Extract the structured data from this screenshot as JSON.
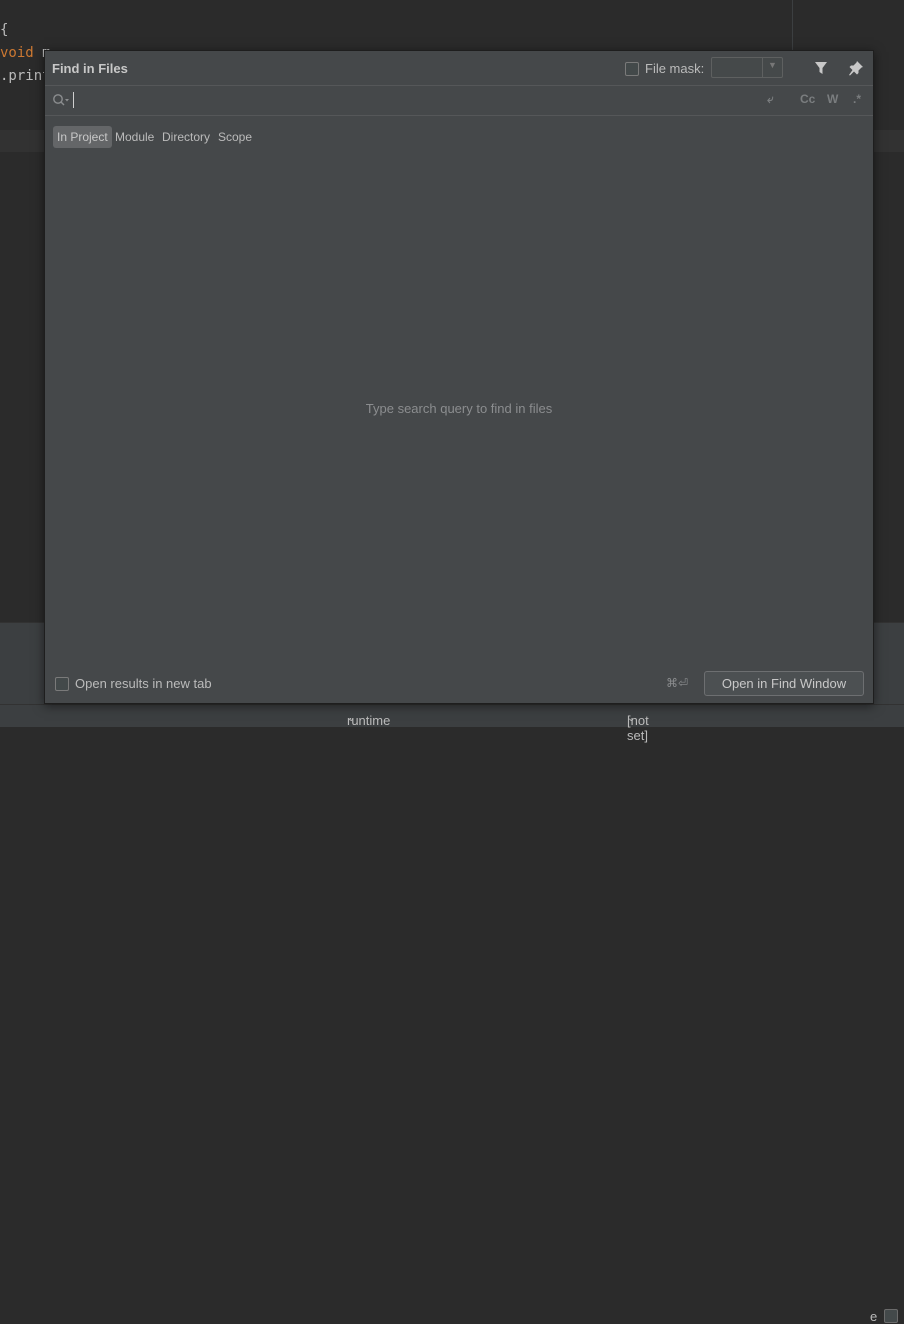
{
  "editor": {
    "line1": "{",
    "line2_kw": "void",
    "line2_rest": " m",
    "line3": ".print"
  },
  "status_bar": {
    "runtime": "runtime",
    "not_set": "[not set]",
    "dropdown_glyph": "⌄"
  },
  "background_panel": {
    "right_glyph": "e"
  },
  "dialog": {
    "title": "Find in Files",
    "file_mask_label": "File mask:",
    "file_mask_value": "",
    "file_mask_checked": false,
    "icons": [
      "filter-icon",
      "pin-icon",
      "search-icon",
      "newline-icon",
      "match-case-icon",
      "words-icon",
      "regex-icon"
    ],
    "search": {
      "value": "",
      "placeholder": ""
    },
    "options": {
      "newline": "⤶",
      "match_case": "Cc",
      "words": "W",
      "regex": ".*"
    },
    "scope_tabs": [
      {
        "label": "In Project",
        "active": true
      },
      {
        "label": "Module",
        "active": false
      },
      {
        "label": "Directory",
        "active": false
      },
      {
        "label": "Scope",
        "active": false
      }
    ],
    "empty_message": "Type search query to find in files",
    "open_new_tab_label": "Open results in new tab",
    "open_new_tab_checked": false,
    "shortcut": "⌘⏎",
    "open_find_window_label": "Open in Find Window"
  },
  "colors": {
    "dialog_bg": "#45484a",
    "ide_bg": "#2b2b2b",
    "keyword": "#cc7832",
    "active_tab": "#646668"
  }
}
